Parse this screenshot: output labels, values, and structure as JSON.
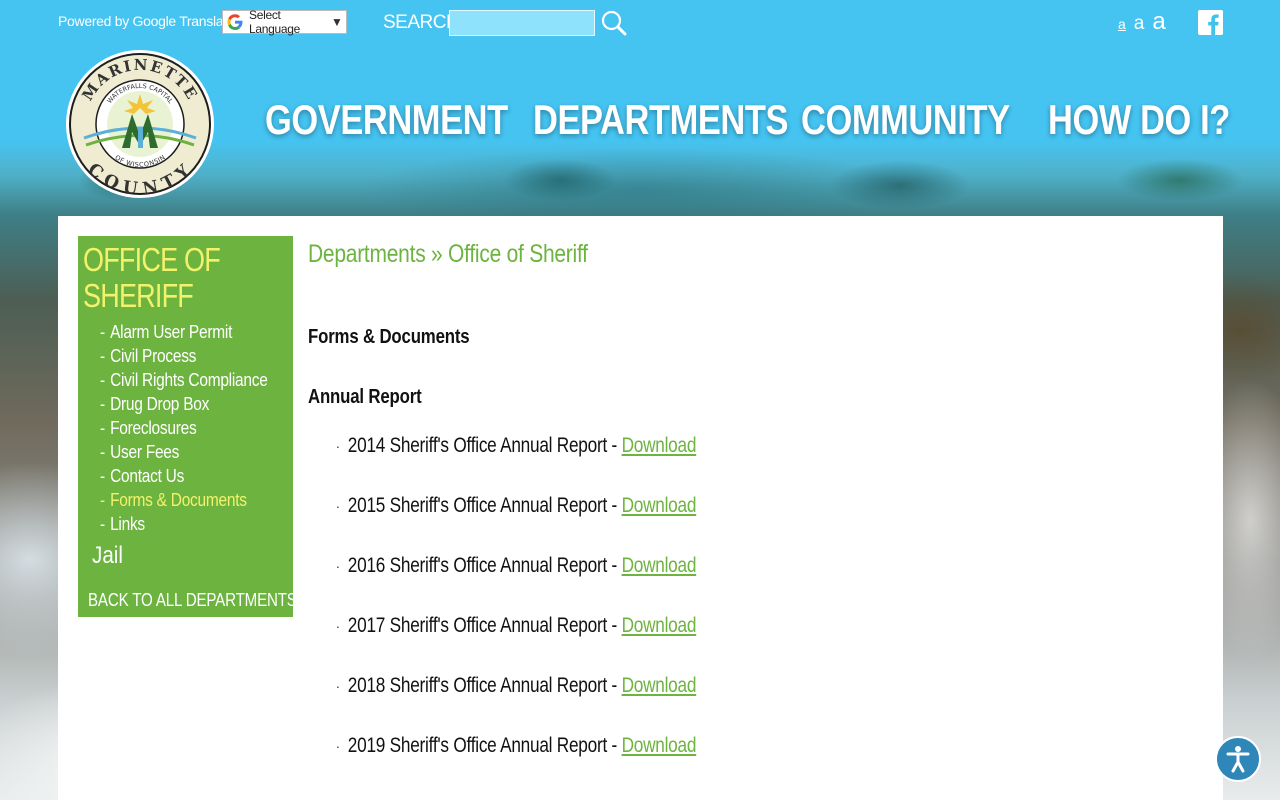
{
  "topbar": {
    "powered_by": "Powered by Google Translate",
    "language_select": "Select Language",
    "search_label": "SEARCH",
    "search_placeholder": "",
    "font_sizes": [
      "a",
      "a",
      "a"
    ],
    "icons": {
      "google": "google-g-icon",
      "search": "search-icon",
      "facebook": "facebook-icon"
    }
  },
  "logo": {
    "top_text": "MARINETTE",
    "inner_top": "WATERFALLS CAPITAL",
    "inner_bottom": "OF WISCONSIN",
    "bottom_text": "COUNTY",
    "letter": "M"
  },
  "nav": {
    "items": [
      "GOVERNMENT",
      "DEPARTMENTS",
      "COMMUNITY",
      "HOW DO I?"
    ]
  },
  "sidebar": {
    "title_line1": "OFFICE OF",
    "title_line2": "SHERIFF",
    "items": [
      {
        "label": "Alarm User Permit"
      },
      {
        "label": "Civil Process"
      },
      {
        "label": "Civil Rights Compliance"
      },
      {
        "label": "Drug Drop Box"
      },
      {
        "label": "Foreclosures"
      },
      {
        "label": "User Fees"
      },
      {
        "label": "Contact Us"
      },
      {
        "label": "Forms & Documents",
        "active": true
      },
      {
        "label": "Links"
      }
    ],
    "jail": "Jail",
    "back": "BACK TO ALL DEPARTMENTS"
  },
  "main": {
    "breadcrumb": {
      "part1": "Departments",
      "sep": " » ",
      "part2": "Office of Sheriff"
    },
    "heading": "Forms & Documents",
    "subheading": "Annual Report",
    "reports": [
      {
        "text": "2014 Sheriff's Office Annual Report - ",
        "link": "Download"
      },
      {
        "text": "2015 Sheriff's Office Annual Report - ",
        "link": "Download"
      },
      {
        "text": "2016 Sheriff's Office Annual Report - ",
        "link": "Download"
      },
      {
        "text": "2017 Sheriff's Office Annual Report - ",
        "link": "Download"
      },
      {
        "text": "2018 Sheriff's Office Annual Report - ",
        "link": "Download"
      },
      {
        "text": "2019 Sheriff's Office Annual Report - ",
        "link": "Download"
      }
    ]
  },
  "accessibility": {
    "icon": "accessibility-icon"
  },
  "colors": {
    "sky": "#3ec3ea",
    "green": "#6db33f",
    "yellow": "#f3f26b",
    "access": "#2f86b8"
  }
}
